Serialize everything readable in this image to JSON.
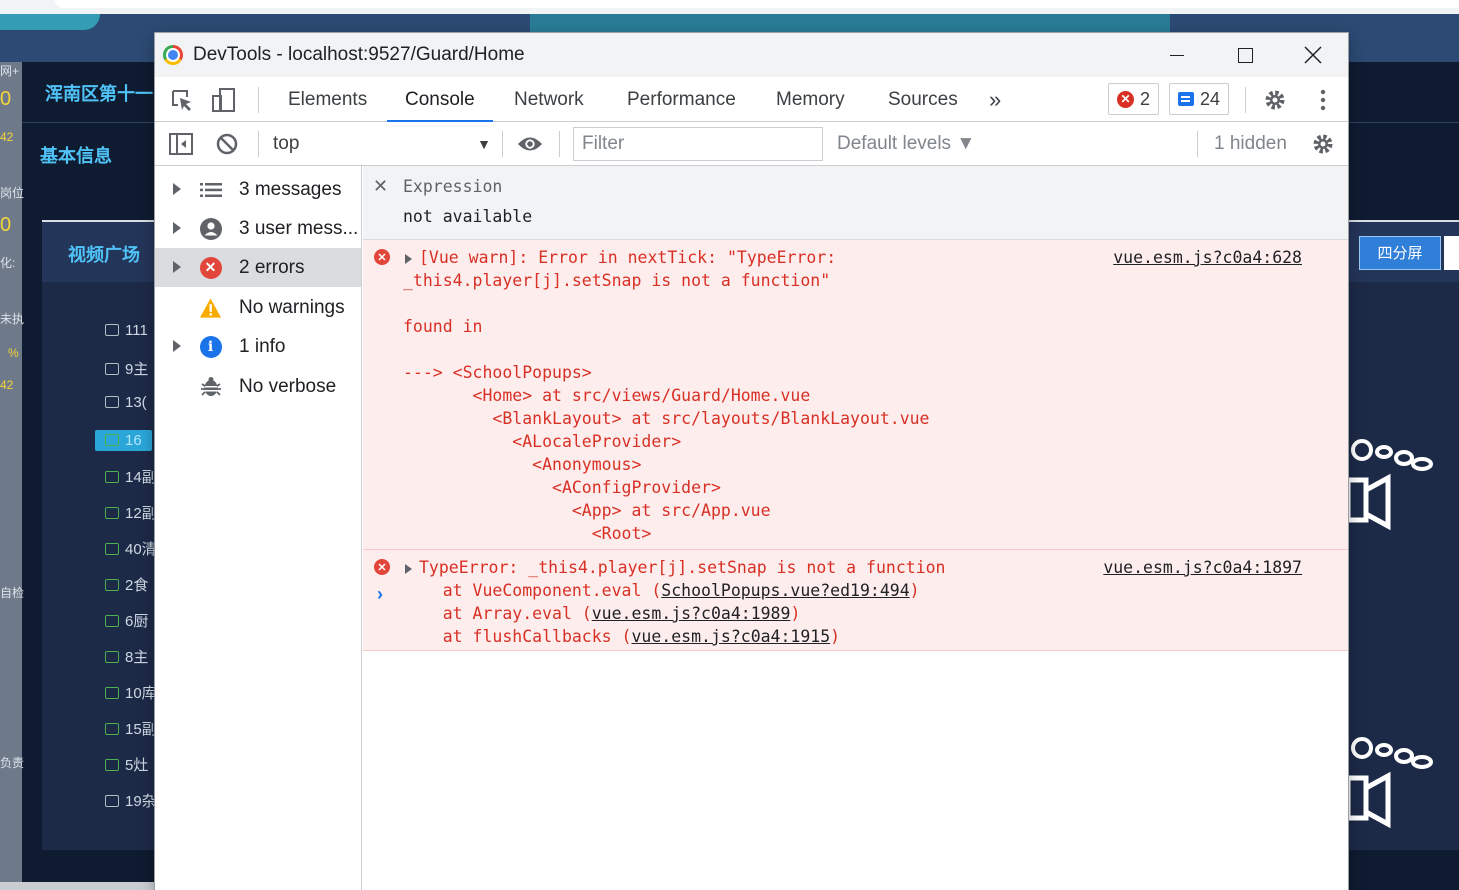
{
  "background": {
    "header_title": "浑南区第十一",
    "basic_info": "基本信息",
    "video_square": "视频广场",
    "split_button": "四分屏",
    "left_labels": [
      "网+",
      "0",
      "42",
      "岗位",
      "0",
      "化:",
      "未执",
      "%",
      "42",
      "自检",
      "负责"
    ],
    "list_items": [
      {
        "label": "111",
        "online": false
      },
      {
        "label": "9主",
        "online": false
      },
      {
        "label": "13(",
        "online": false
      },
      {
        "label": "16",
        "online": true,
        "active": true
      },
      {
        "label": "14副",
        "online": true
      },
      {
        "label": "12副",
        "online": true
      },
      {
        "label": "40清",
        "online": true
      },
      {
        "label": "2食",
        "online": true
      },
      {
        "label": "6厨",
        "online": true
      },
      {
        "label": "8主",
        "online": true
      },
      {
        "label": "10库",
        "online": true
      },
      {
        "label": "15副",
        "online": true
      },
      {
        "label": "5灶",
        "online": true
      },
      {
        "label": "19杂",
        "online": false
      }
    ]
  },
  "window": {
    "title": "DevTools - localhost:9527/Guard/Home"
  },
  "tabs": [
    {
      "label": "Elements",
      "active": false
    },
    {
      "label": "Console",
      "active": true
    },
    {
      "label": "Network",
      "active": false
    },
    {
      "label": "Performance",
      "active": false
    },
    {
      "label": "Memory",
      "active": false
    },
    {
      "label": "Sources",
      "active": false
    }
  ],
  "more_tabs": "»",
  "counters": {
    "errors": "2",
    "messages": "24"
  },
  "toolbar": {
    "context": "top",
    "filter_placeholder": "Filter",
    "levels": "Default levels ▼",
    "hidden": "1 hidden"
  },
  "sidebar": [
    {
      "label": "3 messages",
      "icon": "list-icon",
      "expandable": true,
      "selected": false
    },
    {
      "label": "3 user mess...",
      "icon": "user-icon",
      "expandable": true,
      "selected": false
    },
    {
      "label": "2 errors",
      "icon": "error-icon",
      "expandable": true,
      "selected": true
    },
    {
      "label": "No warnings",
      "icon": "warning-icon",
      "expandable": false,
      "selected": false
    },
    {
      "label": "1 info",
      "icon": "info-icon",
      "expandable": true,
      "selected": false
    },
    {
      "label": "No verbose",
      "icon": "bug-icon",
      "expandable": false,
      "selected": false
    }
  ],
  "expression": {
    "name": "Expression",
    "value": "not available"
  },
  "error1": {
    "lines": [
      "[Vue warn]: Error in nextTick: \"TypeError:",
      "_this4.player[j].setSnap is not a function\"",
      "",
      "found in",
      "",
      "---> <SchoolPopups>",
      "       <Home> at src/views/Guard/Home.vue",
      "         <BlankLayout> at src/layouts/BlankLayout.vue",
      "           <ALocaleProvider>",
      "             <Anonymous>",
      "               <AConfigProvider>",
      "                 <App> at src/App.vue",
      "                   <Root>"
    ],
    "source": "vue.esm.js?c0a4:628"
  },
  "error2": {
    "message": "TypeError: _this4.player[j].setSnap is not a function",
    "source": "vue.esm.js?c0a4:1897",
    "stack": [
      {
        "prefix": "    at VueComponent.eval (",
        "link": "SchoolPopups.vue?ed19:494",
        "suffix": ")"
      },
      {
        "prefix": "    at Array.eval (",
        "link": "vue.esm.js?c0a4:1989",
        "suffix": ")"
      },
      {
        "prefix": "    at flushCallbacks (",
        "link": "vue.esm.js?c0a4:1915",
        "suffix": ")"
      }
    ]
  },
  "prompt": "›",
  "colors": {
    "error_bg": "#fdeded",
    "error_text": "#d93025",
    "accent": "#1a73e8"
  }
}
